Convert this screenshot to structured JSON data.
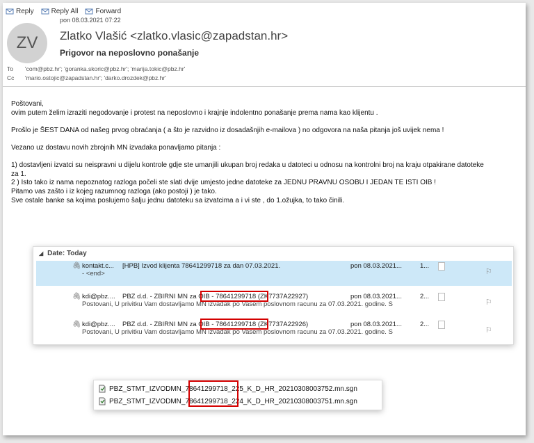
{
  "toolbar": {
    "reply": "Reply",
    "reply_all": "Reply All",
    "forward": "Forward"
  },
  "header": {
    "date": "pon 08.03.2021 07:22",
    "avatar_initials": "ZV",
    "sender": "Zlatko Vlašić <zlatko.vlasic@zapadstan.hr>",
    "subject": "Prigovor na neposlovno ponašanje",
    "to_label": "To",
    "to": "'com@pbz.hr'; 'goranka.skoric@pbz.hr'; 'marija.tokic@pbz.hr'",
    "cc_label": "Cc",
    "cc": "'mario.ostojic@zapadstan.hr'; 'darko.drozdek@pbz.hr'"
  },
  "body": {
    "l1": "Poštovani,",
    "l2": "ovim putem želim izraziti negodovanje i protest na neposlovno i krajnje indolentno ponašanje prema nama kao klijentu .",
    "l3": "Prošlo je ŠEST DANA od našeg prvog obraćanja ( a što je razvidno iz dosadašnjih e-mailova ) no odgovora na naša pitanja još uvijek nema !",
    "l4": "Vezano uz dostavu novih  zbrojnih  MN izvadaka  ponavljamo pitanja :",
    "l5": "1)  dostavljeni izvatci su  neispravni u dijelu kontrole gdje ste umanjili ukupan broj redaka u datoteci u odnosu na kontrolni broj na kraju otpakirane datoteke",
    "l6": "za 1.",
    "l7": "2 ) Isto tako iz nama nepoznatog razloga počeli ste slati dvije umjesto jedne datoteke za JEDNU PRAVNU OSOBU I JEDAN TE ISTI OIB !",
    "l8": "Pitamo vas zašto i iz kojeg razumnog razloga (ako postoji )  je tako.",
    "l9": "Sve ostale banke sa kojima poslujemo šalju jednu datoteku sa izvatcima a i vi ste , do 1.ožujka, to tako činili."
  },
  "mail_list": {
    "group": "Date: Today",
    "rows": [
      {
        "from": "kontakt.c...",
        "subject": "[HPB] Izvod klijenta 78641299718 za dan 07.03.2021.",
        "received": "pon 08.03.2021...",
        "size": "1...",
        "preview": "- <end>"
      },
      {
        "from": "kdi@pbz....",
        "subject": "PBZ d.d. - ZBIRNI MN za OIB - 78641299718 (ZK7737A22927)",
        "received": "pon 08.03.2021...",
        "size": "2...",
        "preview": "Postovani,  U privitku Vam dostavljamo MN izvadak po Vasem poslovnom racunu za 07.03.2021. godine.  S"
      },
      {
        "from": "kdi@pbz....",
        "subject": "PBZ d.d. - ZBIRNI MN za OIB - 78641299718 (ZK7737A22926)",
        "received": "pon 08.03.2021...",
        "size": "2...",
        "preview": "Postovani,  U privitku Vam dostavljamo MN izvadak po Vasem poslovnom racunu za 07.03.2021. godine.  S"
      }
    ]
  },
  "files": [
    "PBZ_STMT_IZVODMN_78641299718_225_K_D_HR_20210308003752.mn.sgn",
    "PBZ_STMT_IZVODMN_78641299718_224_K_D_HR_20210308003751.mn.sgn"
  ],
  "colors": {
    "highlight": "#d40000",
    "selected_row": "#cde8f8",
    "avatar_bg": "#d2d2d2"
  }
}
